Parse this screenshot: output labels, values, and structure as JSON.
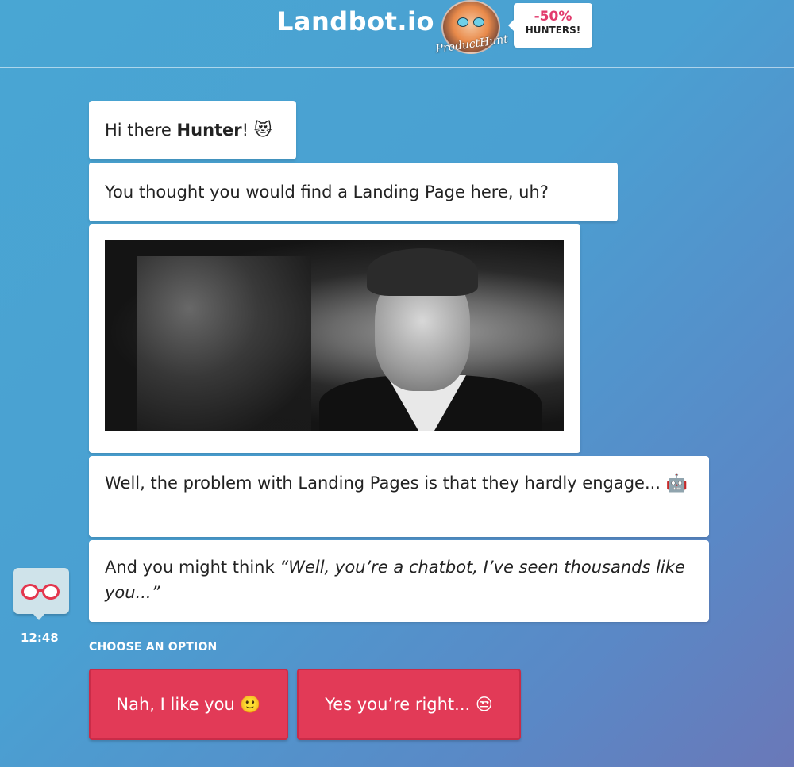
{
  "header": {
    "brand": "Landbot.io",
    "discount_pct": "-50%",
    "discount_label": "HUNTERS!",
    "signature": "ProductHunt"
  },
  "messages": [
    {
      "parts": [
        {
          "t": "Hi there "
        },
        {
          "t": "Hunter",
          "b": true
        },
        {
          "t": "! "
        },
        {
          "emoji": "😻"
        }
      ]
    },
    {
      "parts": [
        {
          "t": "You thought you would find a Landing Page here, uh?"
        }
      ]
    },
    {
      "parts": [
        {
          "t": "Well, the problem with Landing Pages is that they hardly engage... "
        },
        {
          "emoji": "🤖"
        }
      ]
    },
    {
      "parts": [
        {
          "t": "And you might think "
        },
        {
          "t": "“Well, you’re a chatbot, I’ve seen thousands like you...”",
          "i": true
        }
      ]
    }
  ],
  "bot": {
    "time": "12:48"
  },
  "options": {
    "label": "CHOOSE AN OPTION",
    "buttons": [
      "Nah, I like you 🙂",
      "Yes you’re right... 😒"
    ]
  },
  "colors": {
    "accent": "#e23a57",
    "background": "#4aa0d2"
  }
}
